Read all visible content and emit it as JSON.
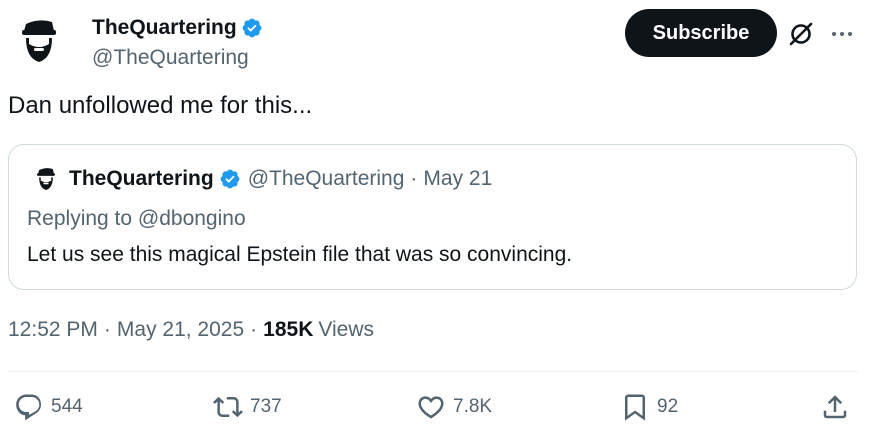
{
  "author": {
    "display_name": "TheQuartering",
    "handle": "@TheQuartering"
  },
  "subscribe_label": "Subscribe",
  "tweet_text": "Dan unfollowed me for this...",
  "quote": {
    "display_name": "TheQuartering",
    "handle": "@TheQuartering",
    "separator": "·",
    "date": "May 21",
    "replying_to": "Replying to @dbongino",
    "text": "Let us see this magical Epstein file that was so convincing."
  },
  "meta": {
    "time": "12:52 PM",
    "sep1": "·",
    "date": "May 21, 2025",
    "sep2": "·",
    "views_count": "185K",
    "views_label": "Views"
  },
  "actions": {
    "replies": "544",
    "reposts": "737",
    "likes": "7.8K",
    "bookmarks": "92"
  },
  "colors": {
    "text": "#0f1419",
    "secondary": "#536471",
    "verified": "#1d9bf0",
    "border": "#cfd9de"
  },
  "icons": [
    "avatar",
    "verified-badge-icon",
    "grok-icon",
    "more-icon",
    "reply-icon",
    "repost-icon",
    "like-icon",
    "bookmark-icon",
    "share-icon"
  ]
}
